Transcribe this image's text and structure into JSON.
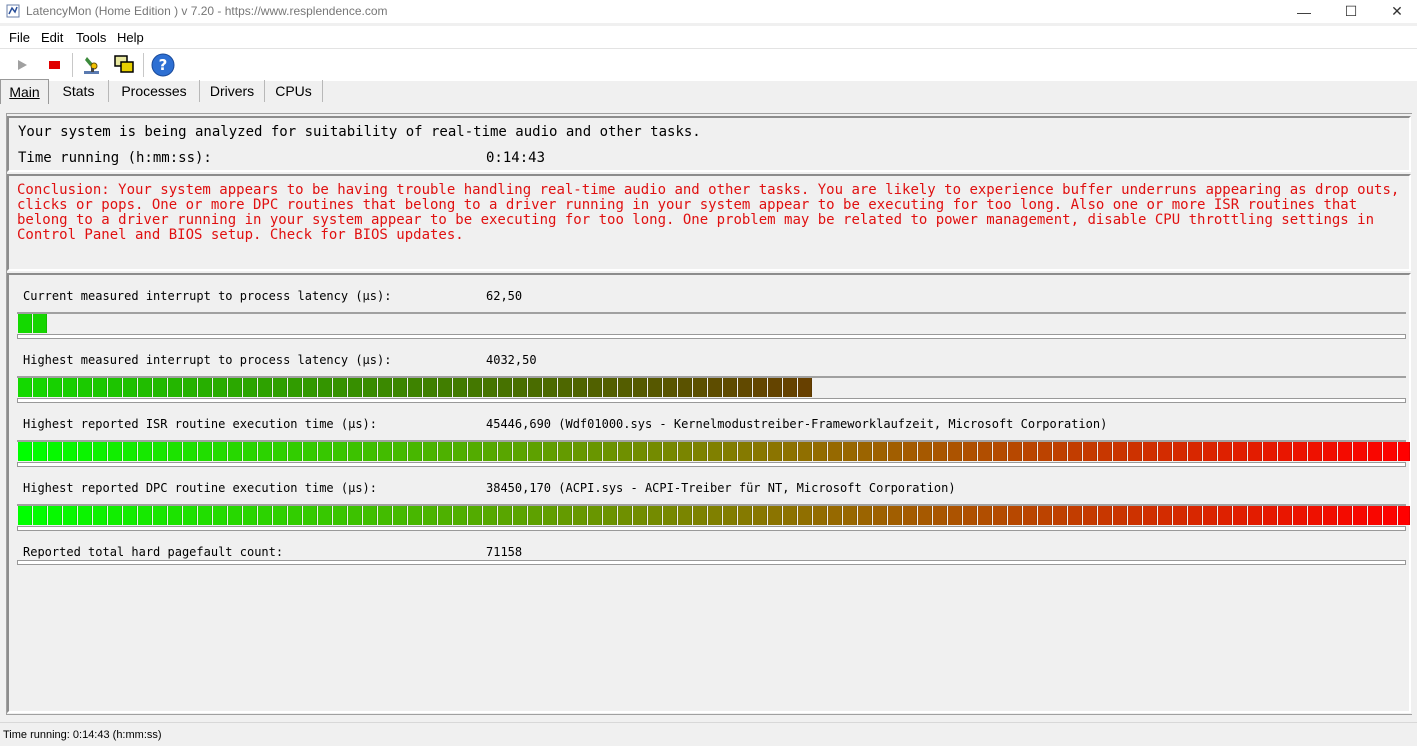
{
  "window": {
    "title": "LatencyMon  (Home Edition )  v 7.20 - https://www.resplendence.com",
    "minimize_glyph": "—",
    "maximize_glyph": "☐",
    "close_glyph": "✕"
  },
  "menu": [
    "File",
    "Edit",
    "Tools",
    "Help"
  ],
  "toolbar": {
    "icons": [
      "play-icon",
      "stop-icon",
      "microscope-icon",
      "windows-icon",
      "help-icon"
    ]
  },
  "tabs": [
    "Main",
    "Stats",
    "Processes",
    "Drivers",
    "CPUs"
  ],
  "main": {
    "intro": "Your system is being analyzed for suitability of real-time audio and other tasks.",
    "time_label": "Time running (h:mm:ss):",
    "time_value": "0:14:43",
    "conclusion": "Conclusion: Your system appears to be having trouble handling real-time audio and other tasks. You are likely to experience buffer underruns appearing as drop outs, clicks or pops. One or more DPC routines that belong to a driver running in your system appear to be executing for too long. Also one or more ISR routines that belong to a driver running in your system appear to be executing for too long. One problem may be related to power management, disable CPU throttling settings in Control Panel and BIOS setup. Check for BIOS updates.",
    "measurements": [
      {
        "label": "Current measured interrupt to process latency (µs):",
        "value": "62,50",
        "fill": 0.022
      },
      {
        "label": "Highest measured interrupt to process latency (µs):",
        "value": "4032,50",
        "fill": 0.575
      },
      {
        "label": "Highest reported ISR routine execution time (µs):",
        "value": "45446,690   (Wdf01000.sys - Kernelmodustreiber-Frameworklaufzeit, Microsoft Corporation)",
        "fill": 1.0
      },
      {
        "label": "Highest reported DPC routine execution time (µs):",
        "value": "38450,170   (ACPI.sys - ACPI-Treiber für NT, Microsoft Corporation)",
        "fill": 1.0
      },
      {
        "label": "Reported total hard pagefault count:",
        "value": "71158",
        "fill": 0
      }
    ]
  },
  "status": "Time running: 0:14:43  (h:mm:ss)",
  "colors": {
    "bar_start": "#00ff00",
    "bar_end": "#ff0000",
    "conclusion_text": "#e01010"
  }
}
